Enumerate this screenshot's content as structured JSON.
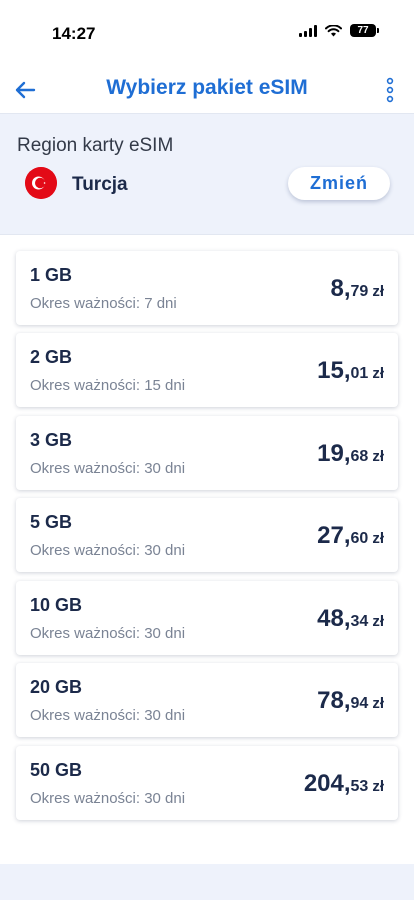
{
  "status_bar": {
    "time": "14:27",
    "battery": "77"
  },
  "header": {
    "title": "Wybierz pakiet eSIM"
  },
  "region": {
    "label": "Region karty eSIM",
    "country": "Turcja",
    "change_label": "Zmień"
  },
  "validity_prefix": "Okres ważności:",
  "packages": [
    {
      "size": "1 GB",
      "validity": "Okres ważności: 7 dni",
      "price_int": "8",
      "price_dec": "79",
      "currency": "zł"
    },
    {
      "size": "2 GB",
      "validity": "Okres ważności: 15 dni",
      "price_int": "15",
      "price_dec": "01",
      "currency": "zł"
    },
    {
      "size": "3 GB",
      "validity": "Okres ważności: 30 dni",
      "price_int": "19",
      "price_dec": "68",
      "currency": "zł"
    },
    {
      "size": "5 GB",
      "validity": "Okres ważności: 30 dni",
      "price_int": "27",
      "price_dec": "60",
      "currency": "zł"
    },
    {
      "size": "10 GB",
      "validity": "Okres ważności: 30 dni",
      "price_int": "48",
      "price_dec": "34",
      "currency": "zł"
    },
    {
      "size": "20 GB",
      "validity": "Okres ważności: 30 dni",
      "price_int": "78",
      "price_dec": "94",
      "currency": "zł"
    },
    {
      "size": "50 GB",
      "validity": "Okres ważności: 30 dni",
      "price_int": "204",
      "price_dec": "53",
      "currency": "zł"
    }
  ],
  "icons": {
    "back": "arrow-left-icon",
    "more": "more-vertical-icon",
    "flag": "turkey-flag-icon"
  },
  "colors": {
    "accent": "#1f6ed4",
    "dark_text": "#1c2a4a",
    "muted_text": "#7a8394",
    "flag_red": "#e30a17"
  }
}
